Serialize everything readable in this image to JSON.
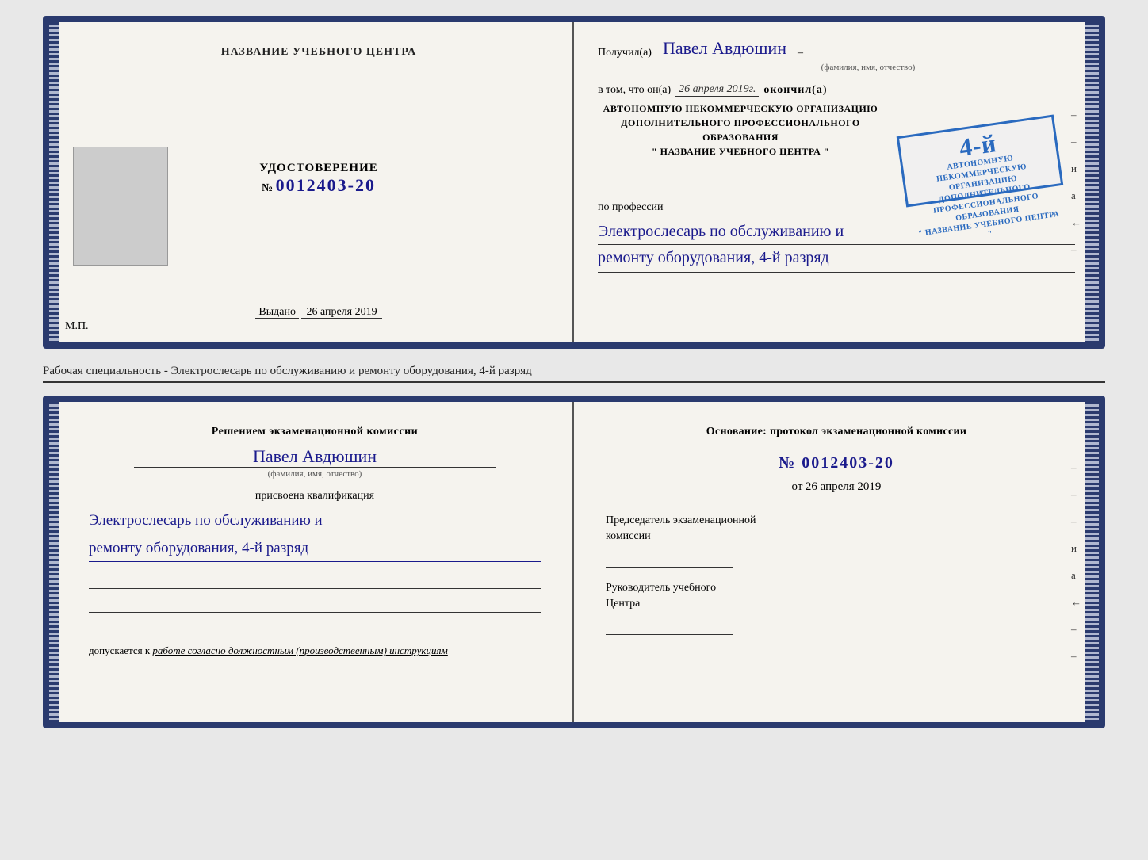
{
  "top_cert": {
    "left": {
      "title": "НАЗВАНИЕ УЧЕБНОГО ЦЕНТРА",
      "doc_label": "УДОСТОВЕРЕНИЕ",
      "doc_number_prefix": "№",
      "doc_number": "0012403-20",
      "issued_label": "Выдано",
      "issued_date": "26 апреля 2019",
      "mp_label": "М.П."
    },
    "right": {
      "received_label": "Получил(а)",
      "name": "Павел Авдюшин",
      "name_sub": "(фамилия, имя, отчество)",
      "in_that_prefix": "в том, что он(а)",
      "date_italic": "26 апреля 2019г.",
      "finished": "окончил(а)",
      "dash": "–",
      "grade": "4-й",
      "org_line1": "АВТОНОМНУЮ НЕКОММЕРЧЕСКУЮ ОРГАНИЗАЦИЮ",
      "org_line2": "ДОПОЛНИТЕЛЬНОГО ПРОФЕССИОНАЛЬНОГО ОБРАЗОВАНИЯ",
      "org_line3": "\"    НАЗВАНИЕ УЧЕБНОГО ЦЕНТРА    \"",
      "profession_label": "по профессии",
      "profession_line1": "Электрослесарь по обслуживанию и",
      "profession_line2": "ремонту оборудования, 4-й разряд"
    }
  },
  "description": "Рабочая специальность - Электрослесарь по обслуживанию и ремонту оборудования, 4-й разряд",
  "bottom_cert": {
    "left": {
      "decision_label": "Решением экзаменационной комиссии",
      "name": "Павел Авдюшин",
      "name_sub": "(фамилия, имя, отчество)",
      "qualification_label": "присвоена квалификация",
      "qualification_line1": "Электрослесарь по обслуживанию и",
      "qualification_line2": "ремонту оборудования, 4-й разряд",
      "admitted_prefix": "допускается к",
      "admitted_italic": "работе согласно должностным (производственным) инструкциям"
    },
    "right": {
      "basis_label": "Основание: протокол экзаменационной комиссии",
      "number_prefix": "№",
      "number": "0012403-20",
      "date_prefix": "от",
      "date": "26 апреля 2019",
      "chairman_label1": "Председатель экзаменационной",
      "chairman_label2": "комиссии",
      "director_label1": "Руководитель учебного",
      "director_label2": "Центра"
    }
  },
  "side_chars": {
    "top": [
      "–",
      "–",
      "–",
      "и",
      "а",
      "←",
      "–"
    ]
  }
}
